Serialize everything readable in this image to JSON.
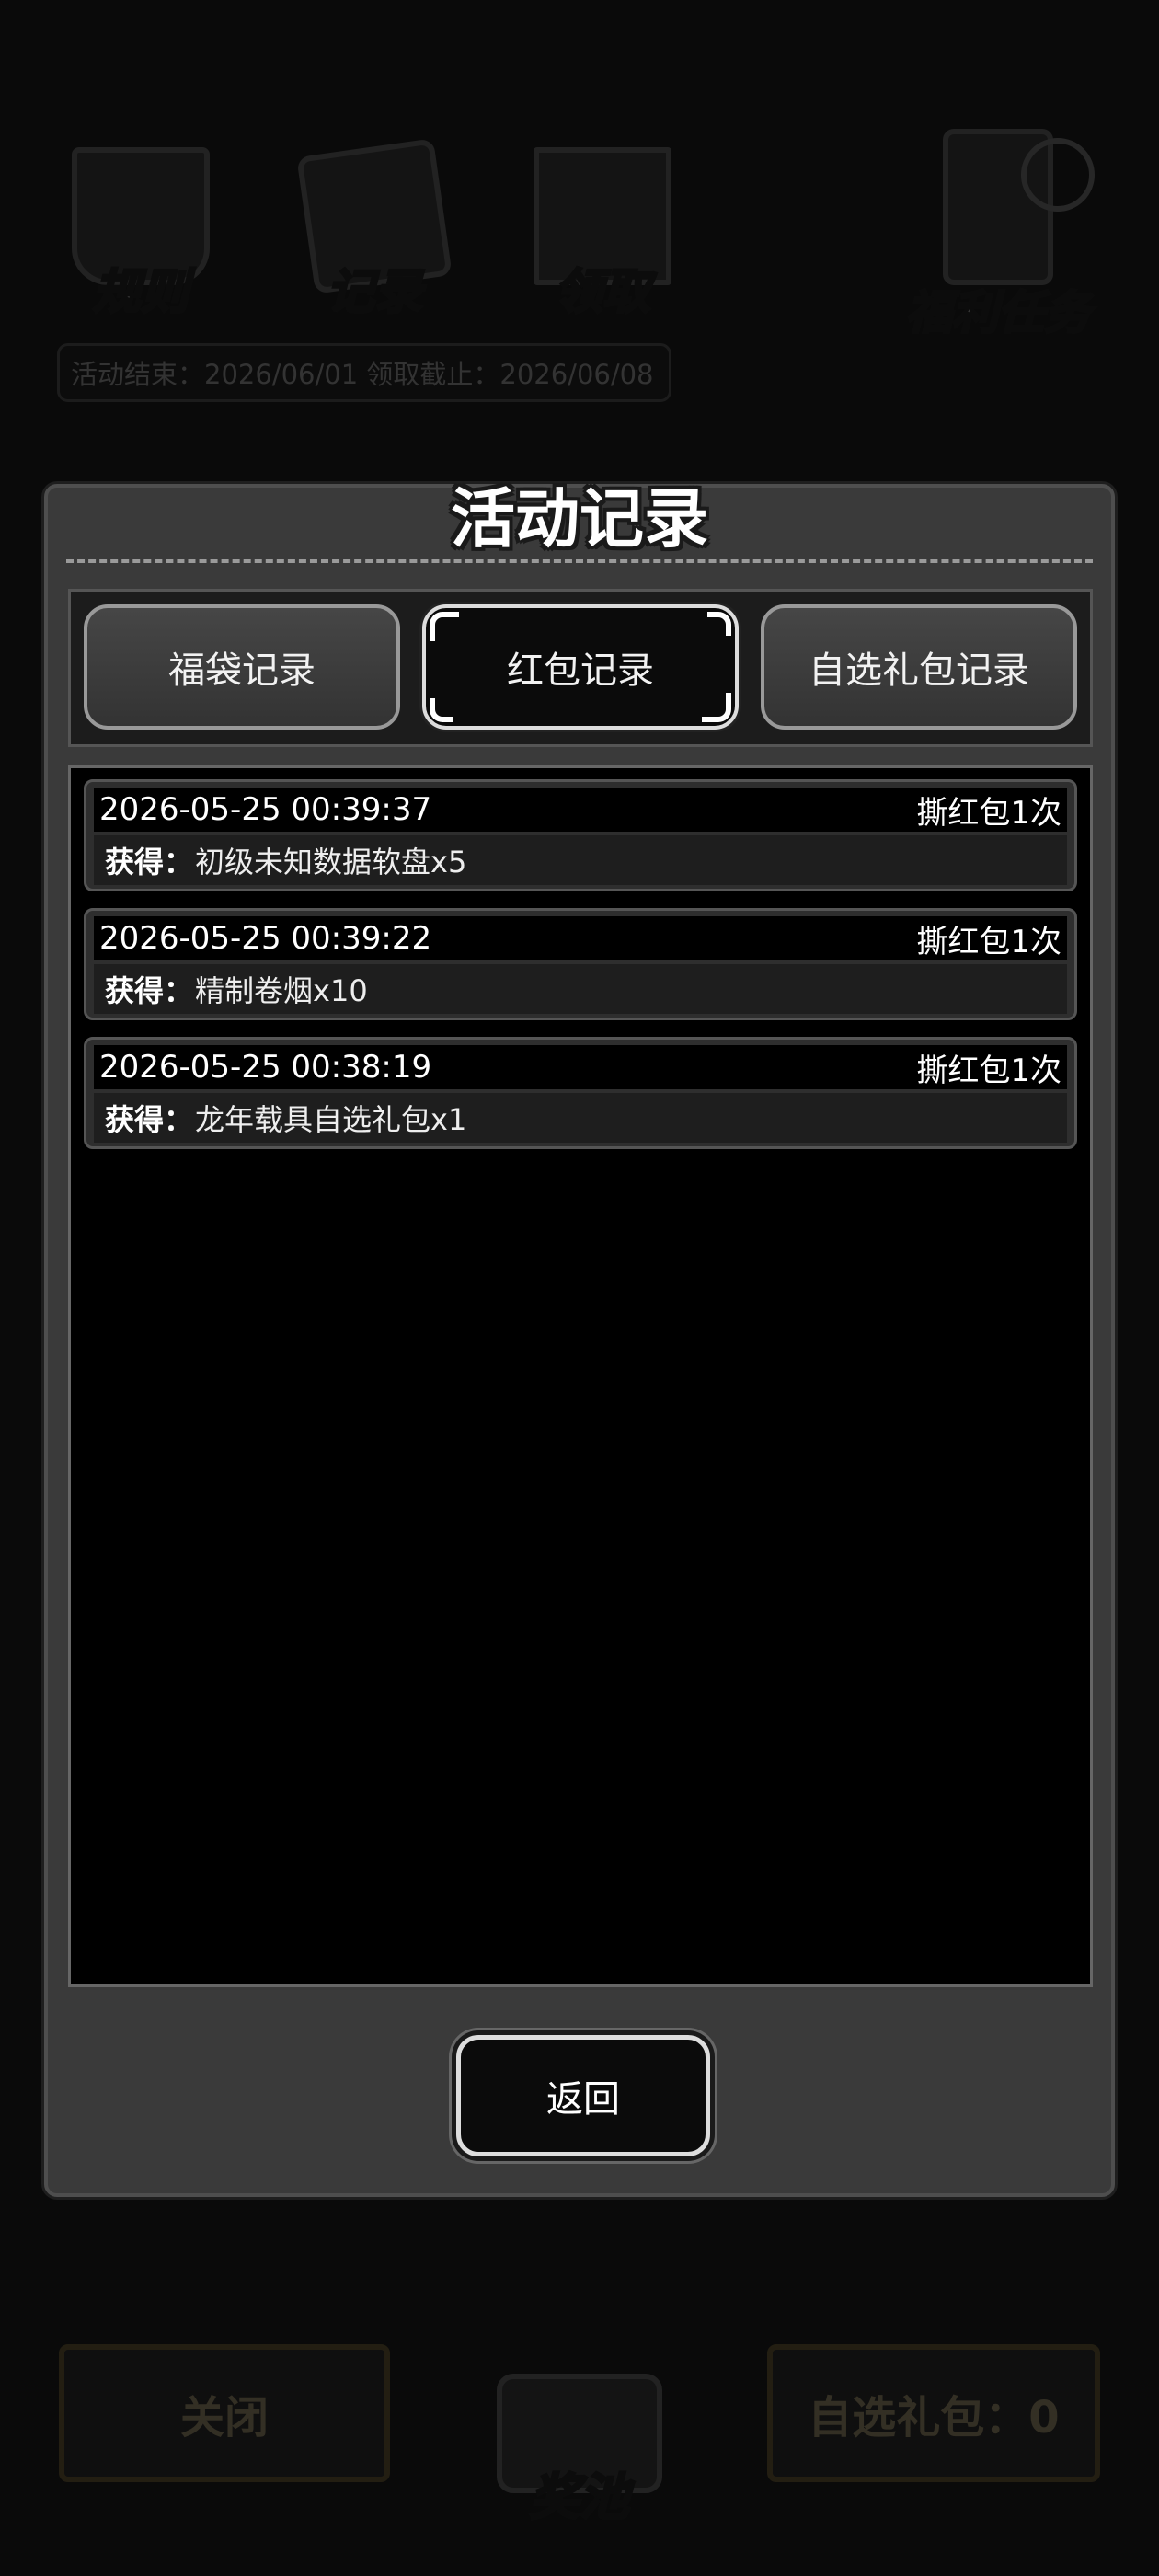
{
  "background": {
    "icons": [
      "规则",
      "记录",
      "领取"
    ],
    "activity_bar": "活动结束：2026/06/01  领取截止：2026/06/08",
    "welfare_task": "福利任务",
    "close_label": "关闭",
    "pool_label": "奖池",
    "optional_pack_label": "自选礼包：0"
  },
  "modal": {
    "title": "活动记录",
    "tabs": [
      {
        "label": "福袋记录",
        "active": false
      },
      {
        "label": "红包记录",
        "active": true
      },
      {
        "label": "自选礼包记录",
        "active": false
      }
    ],
    "get_label": "获得：",
    "records": [
      {
        "time": "2026-05-25 00:39:37",
        "action": "撕红包1次",
        "item": "初级未知数据软盘x5"
      },
      {
        "time": "2026-05-25 00:39:22",
        "action": "撕红包1次",
        "item": "精制卷烟x10"
      },
      {
        "time": "2026-05-25 00:38:19",
        "action": "撕红包1次",
        "item": "龙年载具自选礼包x1"
      }
    ],
    "back_label": "返回"
  },
  "colors": {
    "overlay": "#0a0a0a",
    "modal_bg": "#3a3a3a",
    "panel_bg": "#000000",
    "text": "#ffffff"
  }
}
